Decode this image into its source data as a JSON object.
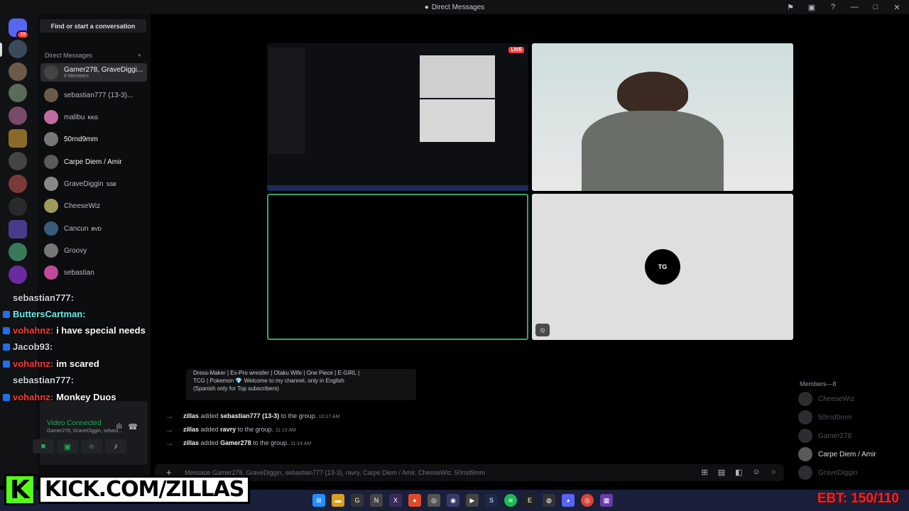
{
  "window": {
    "title": "Direct Messages"
  },
  "sidebar": {
    "find_label": "Find or start a conversation",
    "dm_heading": "Direct Messages",
    "add_icon": "+",
    "items": [
      {
        "name": "Gamer278, GraveDiggi...",
        "sub": "8 Members",
        "active": true
      },
      {
        "name": "sebastian777 (13-3)...",
        "sub": ""
      },
      {
        "name": "malibu",
        "tag": "KKG"
      },
      {
        "name": "50rnd9mm"
      },
      {
        "name": "Carpe Diem / Amir"
      },
      {
        "name": "GraveDiggin",
        "tag": "SSB"
      },
      {
        "name": "CheeseWiz"
      },
      {
        "name": "Cancun",
        "tag": "BVD"
      },
      {
        "name": "Groovy"
      },
      {
        "name": "sebastian"
      }
    ]
  },
  "servers": {
    "home_badge": "18"
  },
  "voice": {
    "status": "Video Connected",
    "channel": "Gamer278, GraveDiggin, sebast..."
  },
  "stage": {
    "live_label": "LIVE"
  },
  "chat": {
    "bio_lines": [
      "Dress-Maker | Ex-Pro wrestler | Otaku Wife | One Piece | E-GIRL |",
      "TCG | Pokemon 💎 Welcome to my channel, only in English",
      "(Spanish only for Top subscribers)"
    ],
    "events": [
      {
        "actor": "zillas",
        "verb": "added",
        "target": "sebastian777 (13-3)",
        "suffix": "to the group.",
        "time": "10:17 AM"
      },
      {
        "actor": "zillas",
        "verb": "added",
        "target": "ravry",
        "suffix": "to the group.",
        "time": "11:13 AM"
      },
      {
        "actor": "zillas",
        "verb": "added",
        "target": "Gamer278",
        "suffix": "to the group.",
        "time": "11:14 AM"
      }
    ],
    "placeholder": "Message Gamer278, GraveDiggin, sebastian777 (13-3), ravry, Carpe Diem / Amir, CheeseWiz, 50rnd9mm"
  },
  "members": {
    "heading": "Members—8",
    "list": [
      {
        "name": "CheeseWiz",
        "online": false
      },
      {
        "name": "50rnd9mm",
        "online": false
      },
      {
        "name": "Gamer278",
        "online": false
      },
      {
        "name": "Carpe Diem / Amir",
        "online": true
      },
      {
        "name": "GraveDiggin",
        "online": false
      }
    ]
  },
  "overlay": {
    "lines": [
      {
        "user": "sebastian777:",
        "msg": ""
      },
      {
        "user": "ButtersCartman:",
        "msg": ""
      },
      {
        "user": "vohahnz:",
        "msg": "i have special needs"
      },
      {
        "user": "Jacob93:",
        "msg": ""
      },
      {
        "user": "vohahnz:",
        "msg": "im scared"
      },
      {
        "user": "sebastian777:",
        "msg": ""
      },
      {
        "user": "vohahnz:",
        "msg": "Monkey Duos"
      }
    ]
  },
  "kick": {
    "logo": "K",
    "url": "KICK.COM/ZILLAS"
  },
  "ebt": "EBT: 150/110",
  "colors": {
    "accent": "#5865f2",
    "online": "#23a55a",
    "kick": "#53fc18",
    "danger": "#f23f43"
  }
}
